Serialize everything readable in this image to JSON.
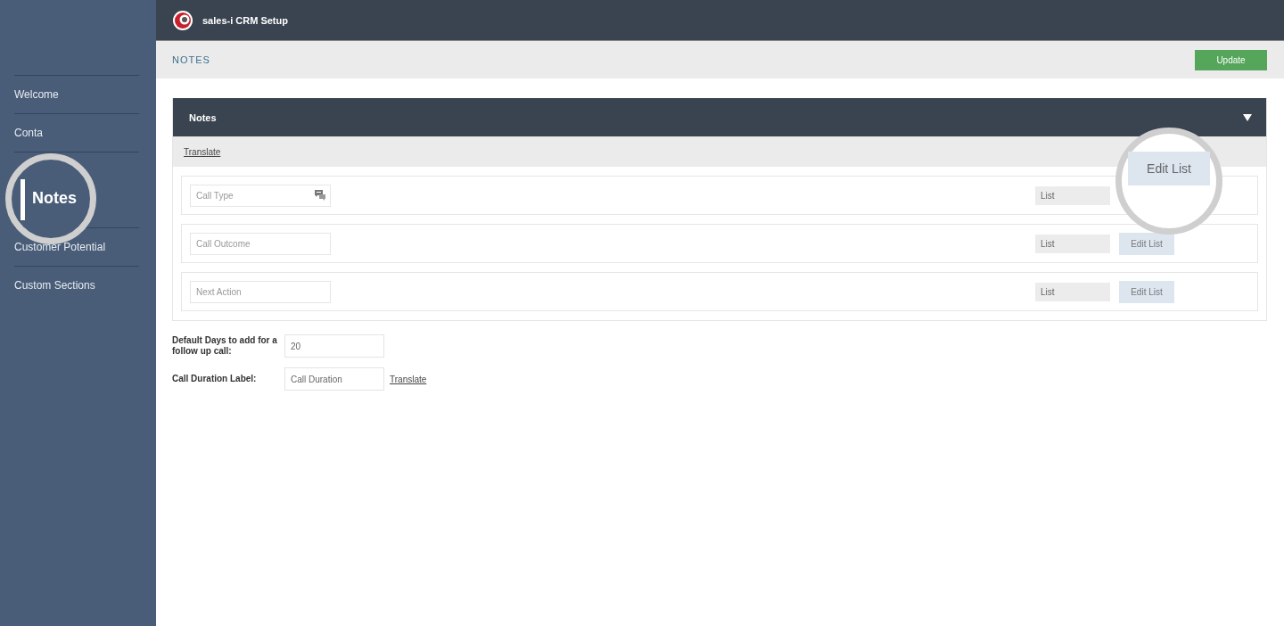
{
  "app": {
    "title": "sales-i CRM Setup"
  },
  "sidebar": {
    "items": [
      {
        "label": "Welcome",
        "selected": false
      },
      {
        "label": "Conta",
        "selected": false
      },
      {
        "label": "Notes",
        "selected": true
      },
      {
        "label": "Customer Potential",
        "selected": false
      },
      {
        "label": "Custom Sections",
        "selected": false
      }
    ]
  },
  "page_header": {
    "title": "NOTES",
    "button": "Update"
  },
  "panel": {
    "title": "Notes",
    "expanded": true,
    "translate_link": "Translate",
    "rows": [
      {
        "placeholder": "Call Type",
        "has_translate_icon": true,
        "type_value": "List",
        "button": "Edit List",
        "magnified": true
      },
      {
        "placeholder": "Call Outcome",
        "has_translate_icon": false,
        "type_value": "List",
        "button": "Edit List",
        "magnified": false
      },
      {
        "placeholder": "Next Action",
        "has_translate_icon": false,
        "type_value": "List",
        "button": "Edit List",
        "magnified": false
      }
    ]
  },
  "settings": [
    {
      "label": "Default Days to add for a follow up call:",
      "value": "20"
    },
    {
      "label": "Call Duration Label:",
      "value": "Call Duration",
      "link": "Translate"
    }
  ]
}
